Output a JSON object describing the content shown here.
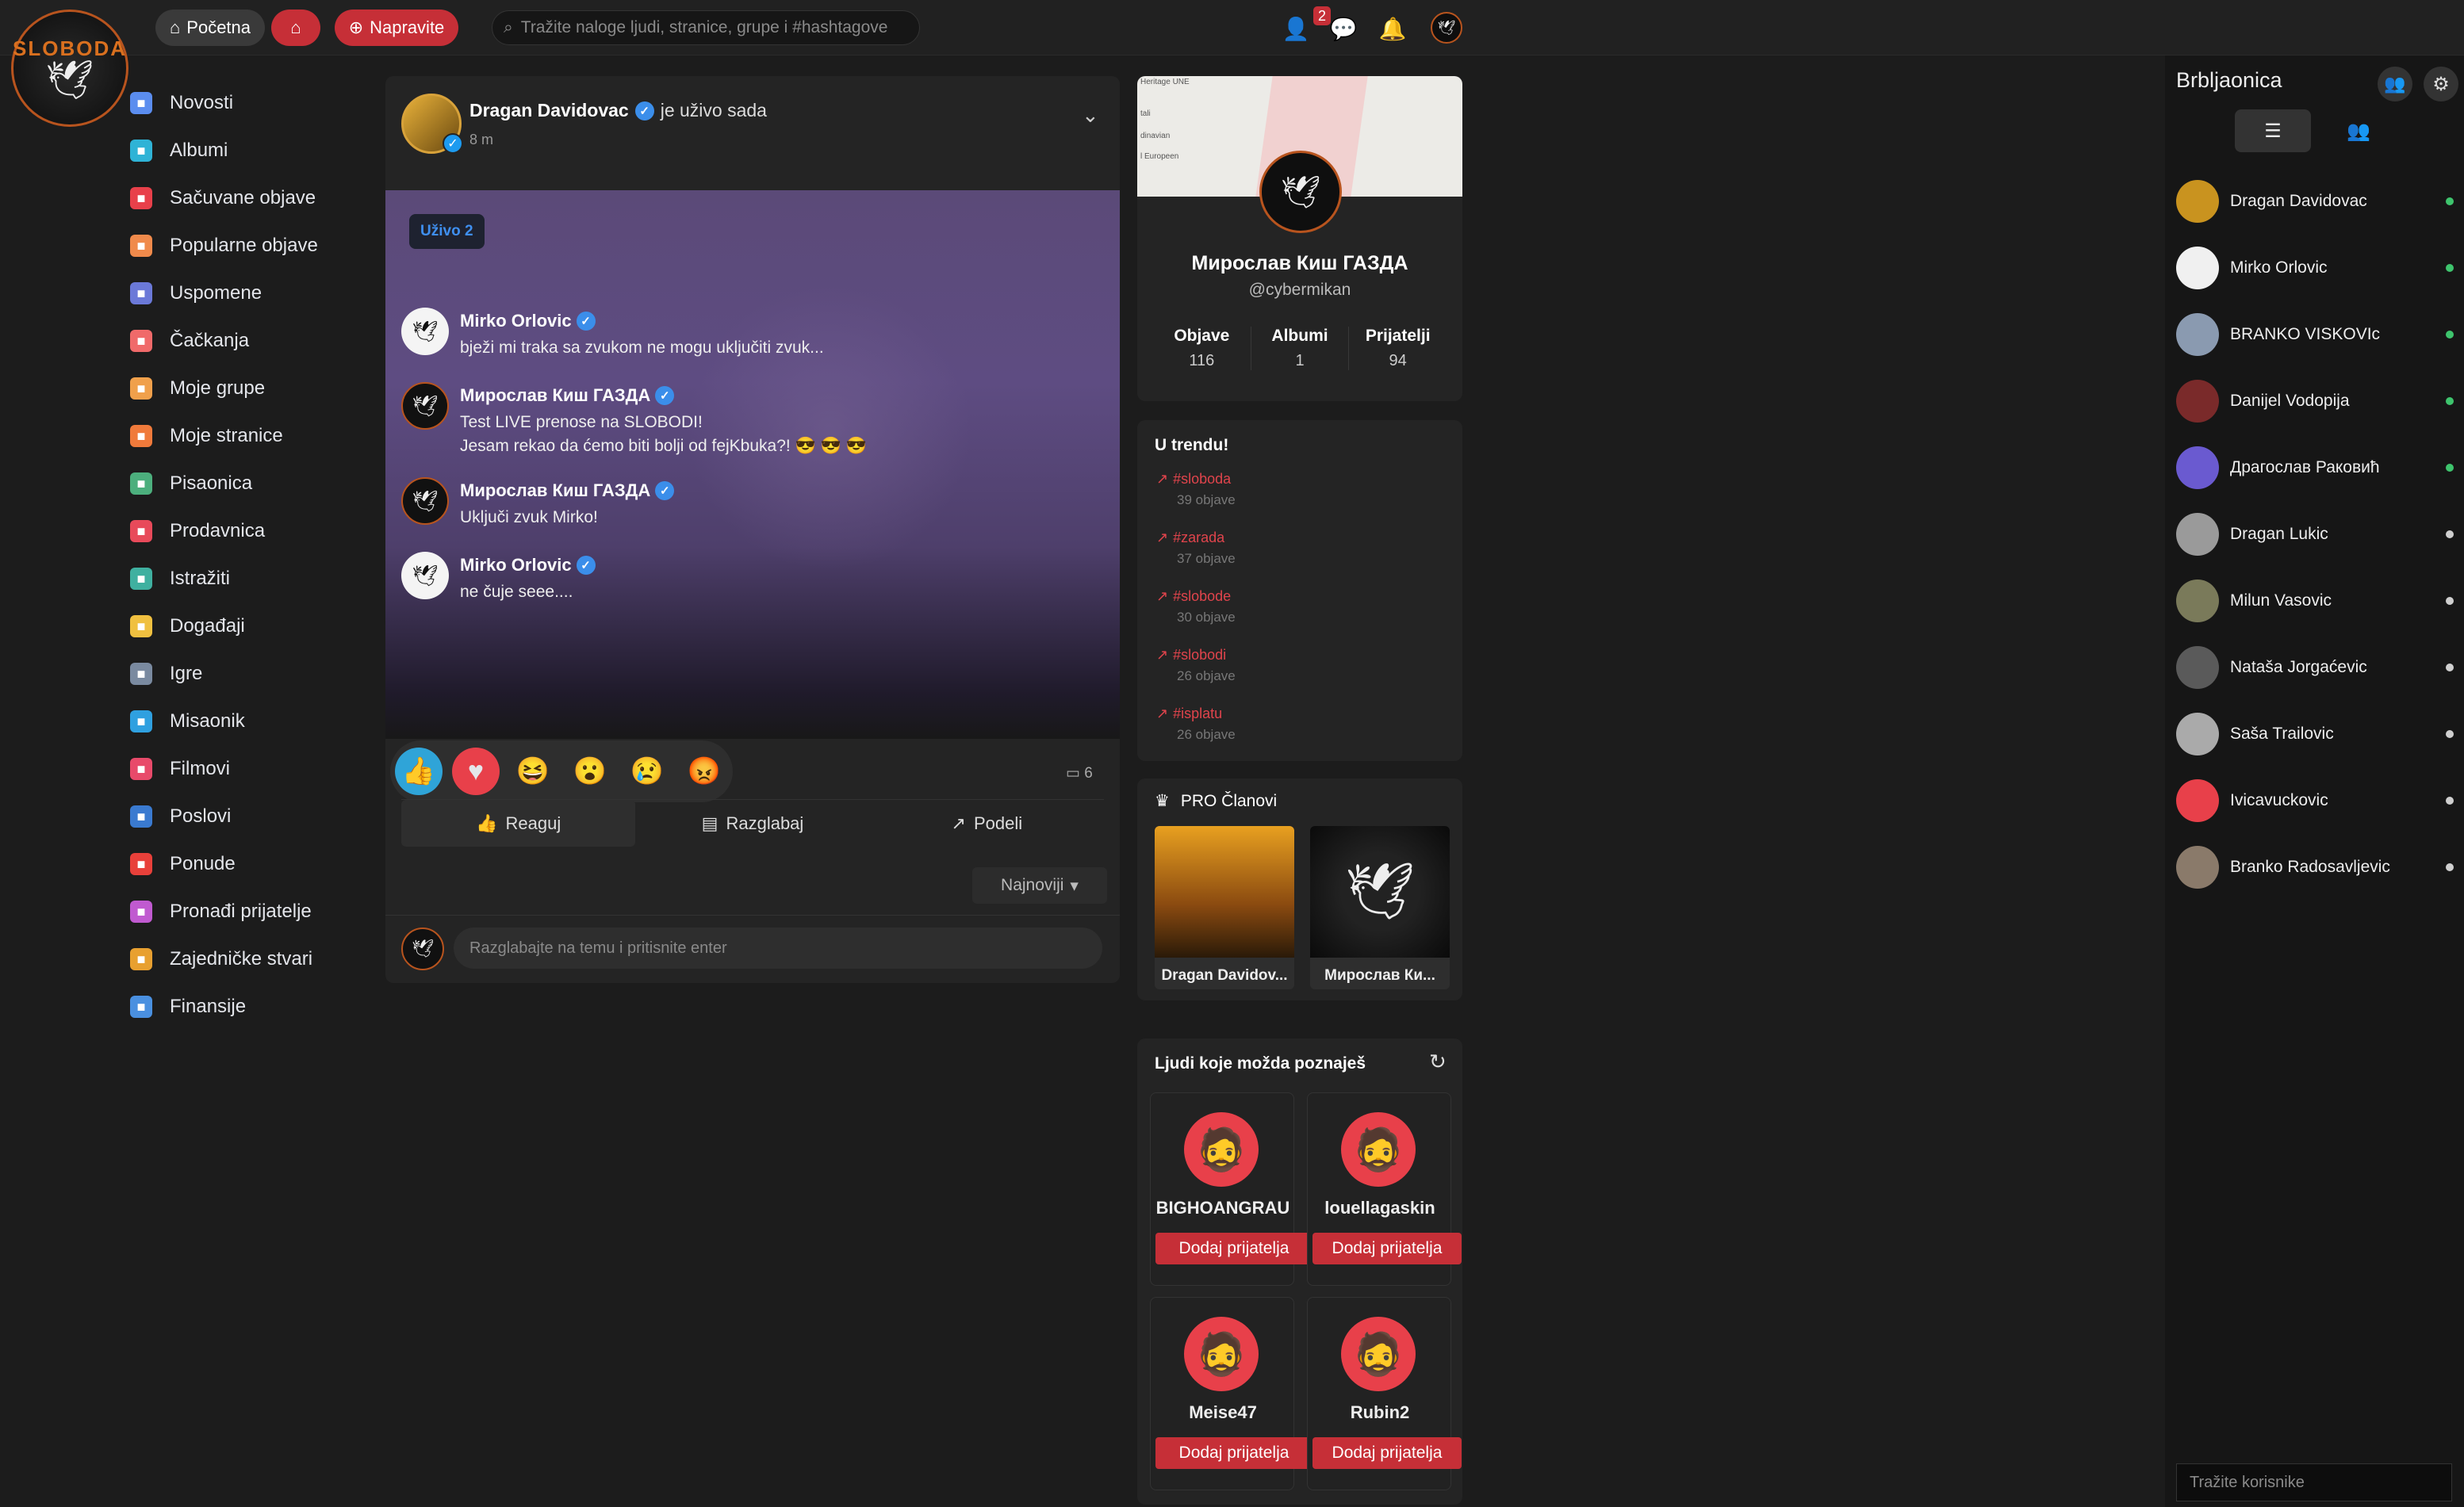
{
  "logo": {
    "text": "SLOBODA"
  },
  "topbar": {
    "home_label": "Početna",
    "create_label": "Napravite",
    "search_placeholder": "Tražite naloge ljudi, stranice, grupe i #hashtagove",
    "messages_badge": "2"
  },
  "nav": {
    "items": [
      {
        "label": "Novosti",
        "color": "#5b8def",
        "icon": "home-icon"
      },
      {
        "label": "Albumi",
        "color": "#2fb3d6",
        "icon": "album-icon"
      },
      {
        "label": "Sačuvane objave",
        "color": "#e8404a",
        "icon": "bookmark-icon"
      },
      {
        "label": "Popularne objave",
        "color": "#f08a4b",
        "icon": "popular-icon"
      },
      {
        "label": "Uspomene",
        "color": "#6b79d8",
        "icon": "memories-icon"
      },
      {
        "label": "Čačkanja",
        "color": "#f06a6a",
        "icon": "poke-icon"
      },
      {
        "label": "Moje grupe",
        "color": "#f0a04b",
        "icon": "groups-icon"
      },
      {
        "label": "Moje stranice",
        "color": "#f07a3b",
        "icon": "pages-icon"
      },
      {
        "label": "Pisaonica",
        "color": "#4caf7d",
        "icon": "blog-icon"
      },
      {
        "label": "Prodavnica",
        "color": "#e84a5a",
        "icon": "store-icon"
      },
      {
        "label": "Istražiti",
        "color": "#3fb0a0",
        "icon": "explore-icon"
      },
      {
        "label": "Događaji",
        "color": "#f0c040",
        "icon": "events-icon"
      },
      {
        "label": "Igre",
        "color": "#7a8aa0",
        "icon": "games-icon"
      },
      {
        "label": "Misaonik",
        "color": "#2fa0e0",
        "icon": "forum-icon"
      },
      {
        "label": "Filmovi",
        "color": "#e84a6a",
        "icon": "movies-icon"
      },
      {
        "label": "Poslovi",
        "color": "#3a7ad0",
        "icon": "jobs-icon"
      },
      {
        "label": "Ponude",
        "color": "#e8403a",
        "icon": "offers-icon"
      },
      {
        "label": "Pronađi prijatelje",
        "color": "#c05ad0",
        "icon": "find-friends-icon"
      },
      {
        "label": "Zajedničke stvari",
        "color": "#e8a030",
        "icon": "common-things-icon"
      },
      {
        "label": "Finansije",
        "color": "#4a90e0",
        "icon": "finance-icon"
      }
    ]
  },
  "post": {
    "author": "Dragan Davidovac",
    "live_text": "je uživo sada",
    "time": "8 m",
    "live_badge": "Uživo 2",
    "comments": [
      {
        "name": "Mirko Orlovic",
        "lines": [
          "bježi mi traka sa zvukom ne mogu uključiti zvuk..."
        ],
        "dark": false
      },
      {
        "name": "Мирослав Киш ГАЗДА",
        "lines": [
          "Test LIVE prenose na SLOBODI!",
          "Jesam rekao da ćemo biti bolji od fejKbuka?! 😎 😎 😎"
        ],
        "dark": true
      },
      {
        "name": "Мирослав Киш ГАЗДА",
        "lines": [
          "Uključi zvuk Mirko!"
        ],
        "dark": true
      },
      {
        "name": "Mirko Orlovic",
        "lines": [
          "ne čuje seee...."
        ],
        "dark": false
      }
    ],
    "comment_count": "6",
    "actions": {
      "react": "Reaguj",
      "discuss": "Razglabaj",
      "share": "Podeli"
    },
    "sort_label": "Najnoviji",
    "comment_placeholder": "Razglabajte na temu i pritisnite enter"
  },
  "profile": {
    "name": "Мирослав Киш ГАЗДА",
    "handle": "@cybermikan",
    "stats": [
      {
        "label": "Objave",
        "value": "116"
      },
      {
        "label": "Albumi",
        "value": "1"
      },
      {
        "label": "Prijatelji",
        "value": "94"
      }
    ],
    "map_labels": [
      "Heritage UNE",
      "tali",
      "dinavian",
      "l Europeen"
    ]
  },
  "trending": {
    "title": "U trendu!",
    "items": [
      {
        "tag": "#sloboda",
        "count": "39 objave"
      },
      {
        "tag": "#zarada",
        "count": "37 objave"
      },
      {
        "tag": "#slobode",
        "count": "30 objave"
      },
      {
        "tag": "#slobodi",
        "count": "26 objave"
      },
      {
        "tag": "#isplatu",
        "count": "26 objave"
      }
    ]
  },
  "pro": {
    "title": "PRO Članovi",
    "members": [
      {
        "name": "Dragan Davidov..."
      },
      {
        "name": "Мирослав Ки..."
      }
    ]
  },
  "people": {
    "title": "Ljudi koje možda poznaješ",
    "button_label": "Dodaj prijatelja",
    "items": [
      {
        "name": "BIGHOANGRAU"
      },
      {
        "name": "louellagaskin"
      },
      {
        "name": "Meise47"
      },
      {
        "name": "Rubin2"
      }
    ]
  },
  "chat": {
    "title": "Brbljaonica",
    "search_placeholder": "Tražite korisnike",
    "users": [
      {
        "name": "Dragan Davidovac",
        "online": true,
        "color": "#c9931f"
      },
      {
        "name": "Mirko Orlovic",
        "online": true,
        "color": "#f0f0f0"
      },
      {
        "name": "BRANKO VISKOVIc",
        "online": true,
        "color": "#8a9ab0"
      },
      {
        "name": "Danijel Vodopija",
        "online": true,
        "color": "#7a2a2a"
      },
      {
        "name": "Драгослав Раковић",
        "online": true,
        "color": "#6a5ad0"
      },
      {
        "name": "Dragan Lukic",
        "online": false,
        "color": "#9a9a9a"
      },
      {
        "name": "Milun Vasovic",
        "online": false,
        "color": "#7a7a5a"
      },
      {
        "name": "Nataša Jorgaćevic",
        "online": false,
        "color": "#5a5a5a"
      },
      {
        "name": "Saša Trailovic",
        "online": false,
        "color": "#aaaaaa"
      },
      {
        "name": "Ivicavuckovic",
        "online": false,
        "color": "#e8404a"
      },
      {
        "name": "Branko Radosavljevic",
        "online": false,
        "color": "#8a7a6a"
      }
    ]
  }
}
